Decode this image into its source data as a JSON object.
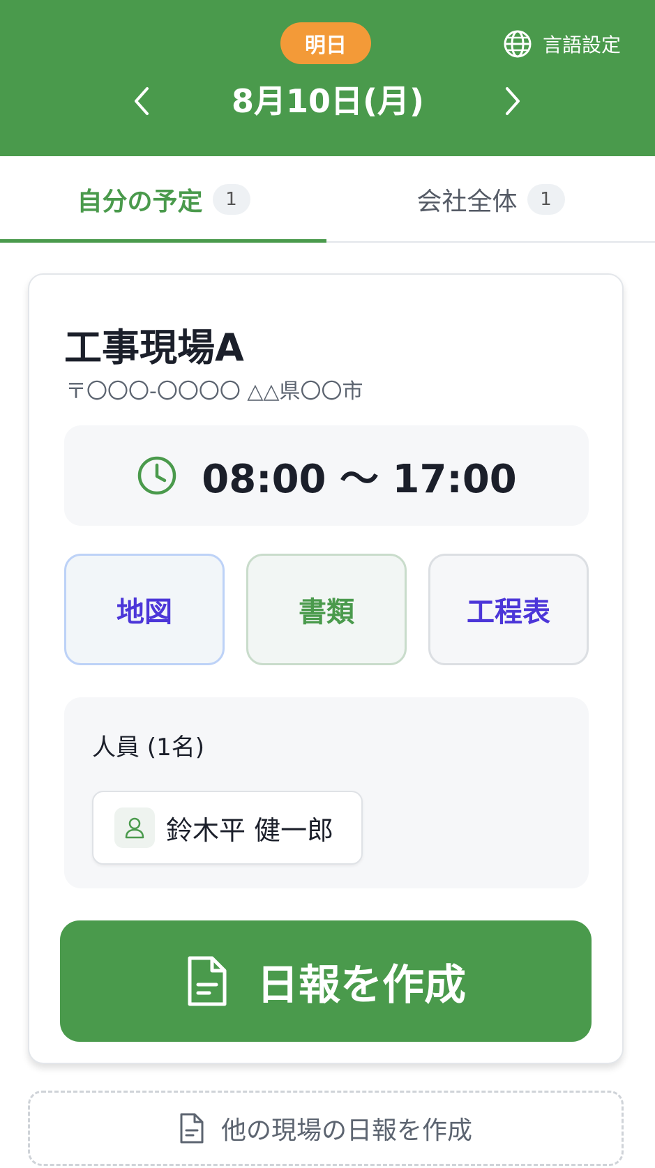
{
  "header": {
    "badge": "明日",
    "date": "8月10日(月)",
    "language_label": "言語設定"
  },
  "tabs": [
    {
      "label": "自分の予定",
      "count": "1"
    },
    {
      "label": "会社全体",
      "count": "1"
    }
  ],
  "site": {
    "name": "工事現場A",
    "address": "〒〇〇〇-〇〇〇〇 △△県〇〇市",
    "time": "08:00 〜 17:00"
  },
  "actions": {
    "map": "地図",
    "documents": "書類",
    "schedule": "工程表"
  },
  "staff": {
    "heading": "人員 (1名)",
    "members": [
      "鈴木平 健一郎"
    ]
  },
  "buttons": {
    "create_report": "日報を作成",
    "create_other_report": "他の現場の日報を作成"
  },
  "colors": {
    "primary_green": "#4a9a4c",
    "badge_orange": "#f39a38",
    "accent_purple": "#4c36d8"
  }
}
